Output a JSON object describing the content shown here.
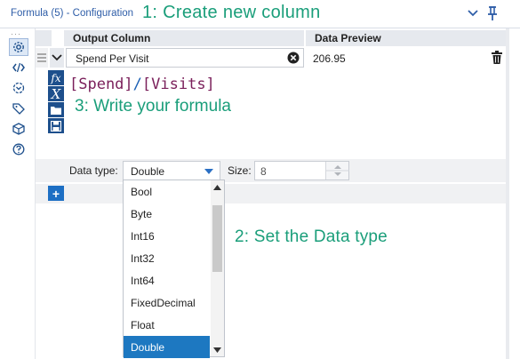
{
  "titlebar": {
    "title": "Formula (5) - Configuration",
    "annotation": "1: Create new column"
  },
  "grid": {
    "col_output": "Output Column",
    "col_preview": "Data Preview",
    "row": {
      "output_value": "Spend Per Visit",
      "preview_value": "206.95"
    }
  },
  "formula": {
    "part1": "[Spend]",
    "operator": "/",
    "part2": "[Visits]",
    "annotation": "3: Write your formula"
  },
  "typebar": {
    "datatype_label": "Data type:",
    "datatype_value": "Double",
    "size_label": "Size:",
    "size_value": "8"
  },
  "dropdown": {
    "options": [
      "Bool",
      "Byte",
      "Int16",
      "Int32",
      "Int64",
      "FixedDecimal",
      "Float",
      "Double"
    ],
    "selected": "Double"
  },
  "annotation2": "2: Set the Data type",
  "colors": {
    "annotation": "#1a9e7a",
    "accent": "#1d78c1",
    "title": "#2f5ea8"
  }
}
